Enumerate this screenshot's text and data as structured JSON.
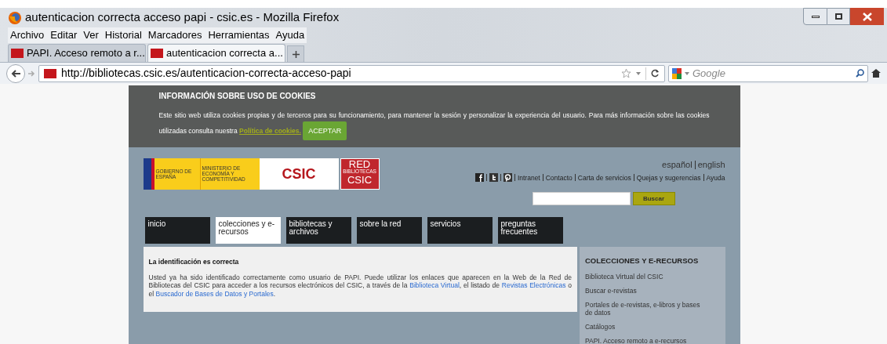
{
  "window": {
    "title": "autenticacion correcta acceso papi - csic.es - Mozilla Firefox"
  },
  "menu": [
    "Archivo",
    "Editar",
    "Ver",
    "Historial",
    "Marcadores",
    "Herramientas",
    "Ayuda"
  ],
  "tabs": [
    {
      "label": "PAPI. Acceso remoto a r...",
      "selected": false
    },
    {
      "label": "autenticacion correcta a...",
      "selected": true
    }
  ],
  "address": {
    "url": "http://bibliotecas.csic.es/autenticacion-correcta-acceso-papi"
  },
  "search": {
    "placeholder": "Google"
  },
  "cookies": {
    "title": "INFORMACIÓN SOBRE USO DE COOKIES",
    "text": "Este sitio web utiliza cookies propias y de terceros para su funcionamiento, para mantener la sesión y personalizar la experiencia del usuario. Para más información sobre las cookies utilizadas consulta nuestra",
    "link": "Política de cookies.",
    "button": "ACEPTAR"
  },
  "logos": {
    "gov_left": "GOBIERNO DE ESPAÑA",
    "gov_right": "MINISTERIO DE ECONOMÍA Y COMPETITIVIDAD",
    "csic": "CSIC",
    "red": "RED",
    "red_sub": "BIBLIOTECAS",
    "red_bottom": "CSIC"
  },
  "languages": [
    "español",
    "english"
  ],
  "top_links": [
    "Intranet",
    "Contacto",
    "Carta de servicios",
    "Quejas y sugerencias",
    "Ayuda"
  ],
  "site_search": {
    "button": "Buscar"
  },
  "nav": [
    {
      "label": "inicio",
      "selected": false
    },
    {
      "label": "colecciones y e-recursos",
      "selected": true
    },
    {
      "label": "bibliotecas y archivos",
      "selected": false
    },
    {
      "label": "sobre la red",
      "selected": false
    },
    {
      "label": "servicios",
      "selected": false
    },
    {
      "label": "preguntas frecuentes",
      "selected": false
    }
  ],
  "content": {
    "title": "La identificación es correcta",
    "paragraph": [
      {
        "text": "Usted ya ha sido identificado correctamente como usuario de PAPI. Puede utilizar los enlaces que aparecen en la Web de la Red de Bibliotecas del CSIC para acceder a los recursos electrónicos del CSIC, a través de la",
        "link": false
      },
      {
        "text": "Biblioteca Virtual",
        "link": true
      },
      {
        "text": ", el listado de",
        "link": false
      },
      {
        "text": "Revistas Electrónicas",
        "link": true
      },
      {
        "text": "o el",
        "link": false
      },
      {
        "text": "Buscador de Bases de Datos y Portales",
        "link": true
      },
      {
        "text": ".",
        "link": false
      }
    ]
  },
  "sidebar": {
    "title": "COLECCIONES Y E-RECURSOS",
    "items": [
      "Biblioteca Virtual del CSIC",
      "Buscar e-revistas",
      "Portales de e-revistas, e-libros y bases de datos",
      "Catálogos",
      "PAPI. Acceso remoto a e-recursos"
    ]
  }
}
